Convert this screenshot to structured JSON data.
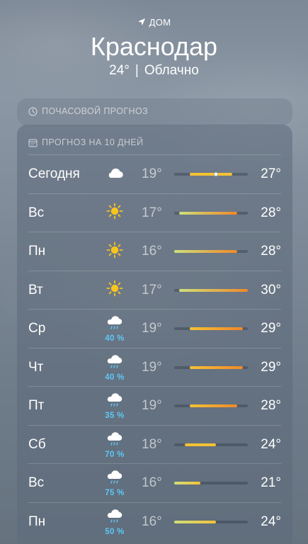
{
  "header": {
    "location_label": "ДОМ",
    "city": "Краснодар",
    "current_temp": "24°",
    "separator": "|",
    "condition": "Облачно"
  },
  "hourly": {
    "title": "ПОЧАСОВОЙ ПРОГНОЗ"
  },
  "daily": {
    "title": "ПРОГНОЗ НА 10 ДНЕЙ",
    "range": {
      "min": 16,
      "max": 30
    },
    "rows": [
      {
        "day": "Сегодня",
        "icon": "cloud-icon",
        "precip": "",
        "lo": "19°",
        "hi": "27°",
        "lo_v": 19,
        "hi_v": 27,
        "current": 24
      },
      {
        "day": "Вс",
        "icon": "sun-icon",
        "precip": "",
        "lo": "17°",
        "hi": "28°",
        "lo_v": 17,
        "hi_v": 28
      },
      {
        "day": "Пн",
        "icon": "sun-icon",
        "precip": "",
        "lo": "16°",
        "hi": "28°",
        "lo_v": 16,
        "hi_v": 28
      },
      {
        "day": "Вт",
        "icon": "sun-icon",
        "precip": "",
        "lo": "17°",
        "hi": "30°",
        "lo_v": 17,
        "hi_v": 30
      },
      {
        "day": "Ср",
        "icon": "rain-cloud-icon",
        "precip": "40 %",
        "lo": "19°",
        "hi": "29°",
        "lo_v": 19,
        "hi_v": 29
      },
      {
        "day": "Чт",
        "icon": "rain-cloud-icon",
        "precip": "40 %",
        "lo": "19°",
        "hi": "29°",
        "lo_v": 19,
        "hi_v": 29
      },
      {
        "day": "Пт",
        "icon": "rain-cloud-icon",
        "precip": "35 %",
        "lo": "19°",
        "hi": "28°",
        "lo_v": 19,
        "hi_v": 28
      },
      {
        "day": "Сб",
        "icon": "rain-cloud-icon",
        "precip": "70 %",
        "lo": "18°",
        "hi": "24°",
        "lo_v": 18,
        "hi_v": 24
      },
      {
        "day": "Вс",
        "icon": "rain-cloud-icon",
        "precip": "75 %",
        "lo": "16°",
        "hi": "21°",
        "lo_v": 16,
        "hi_v": 21
      },
      {
        "day": "Пн",
        "icon": "rain-cloud-icon",
        "precip": "50 %",
        "lo": "16°",
        "hi": "24°",
        "lo_v": 16,
        "hi_v": 24
      }
    ]
  },
  "colors": {
    "sun": "#f7c51e",
    "precip": "#5ec8f5",
    "bar_cool": "#cfe07a",
    "bar_warm": "#f5c235",
    "bar_hot": "#f0882a"
  }
}
